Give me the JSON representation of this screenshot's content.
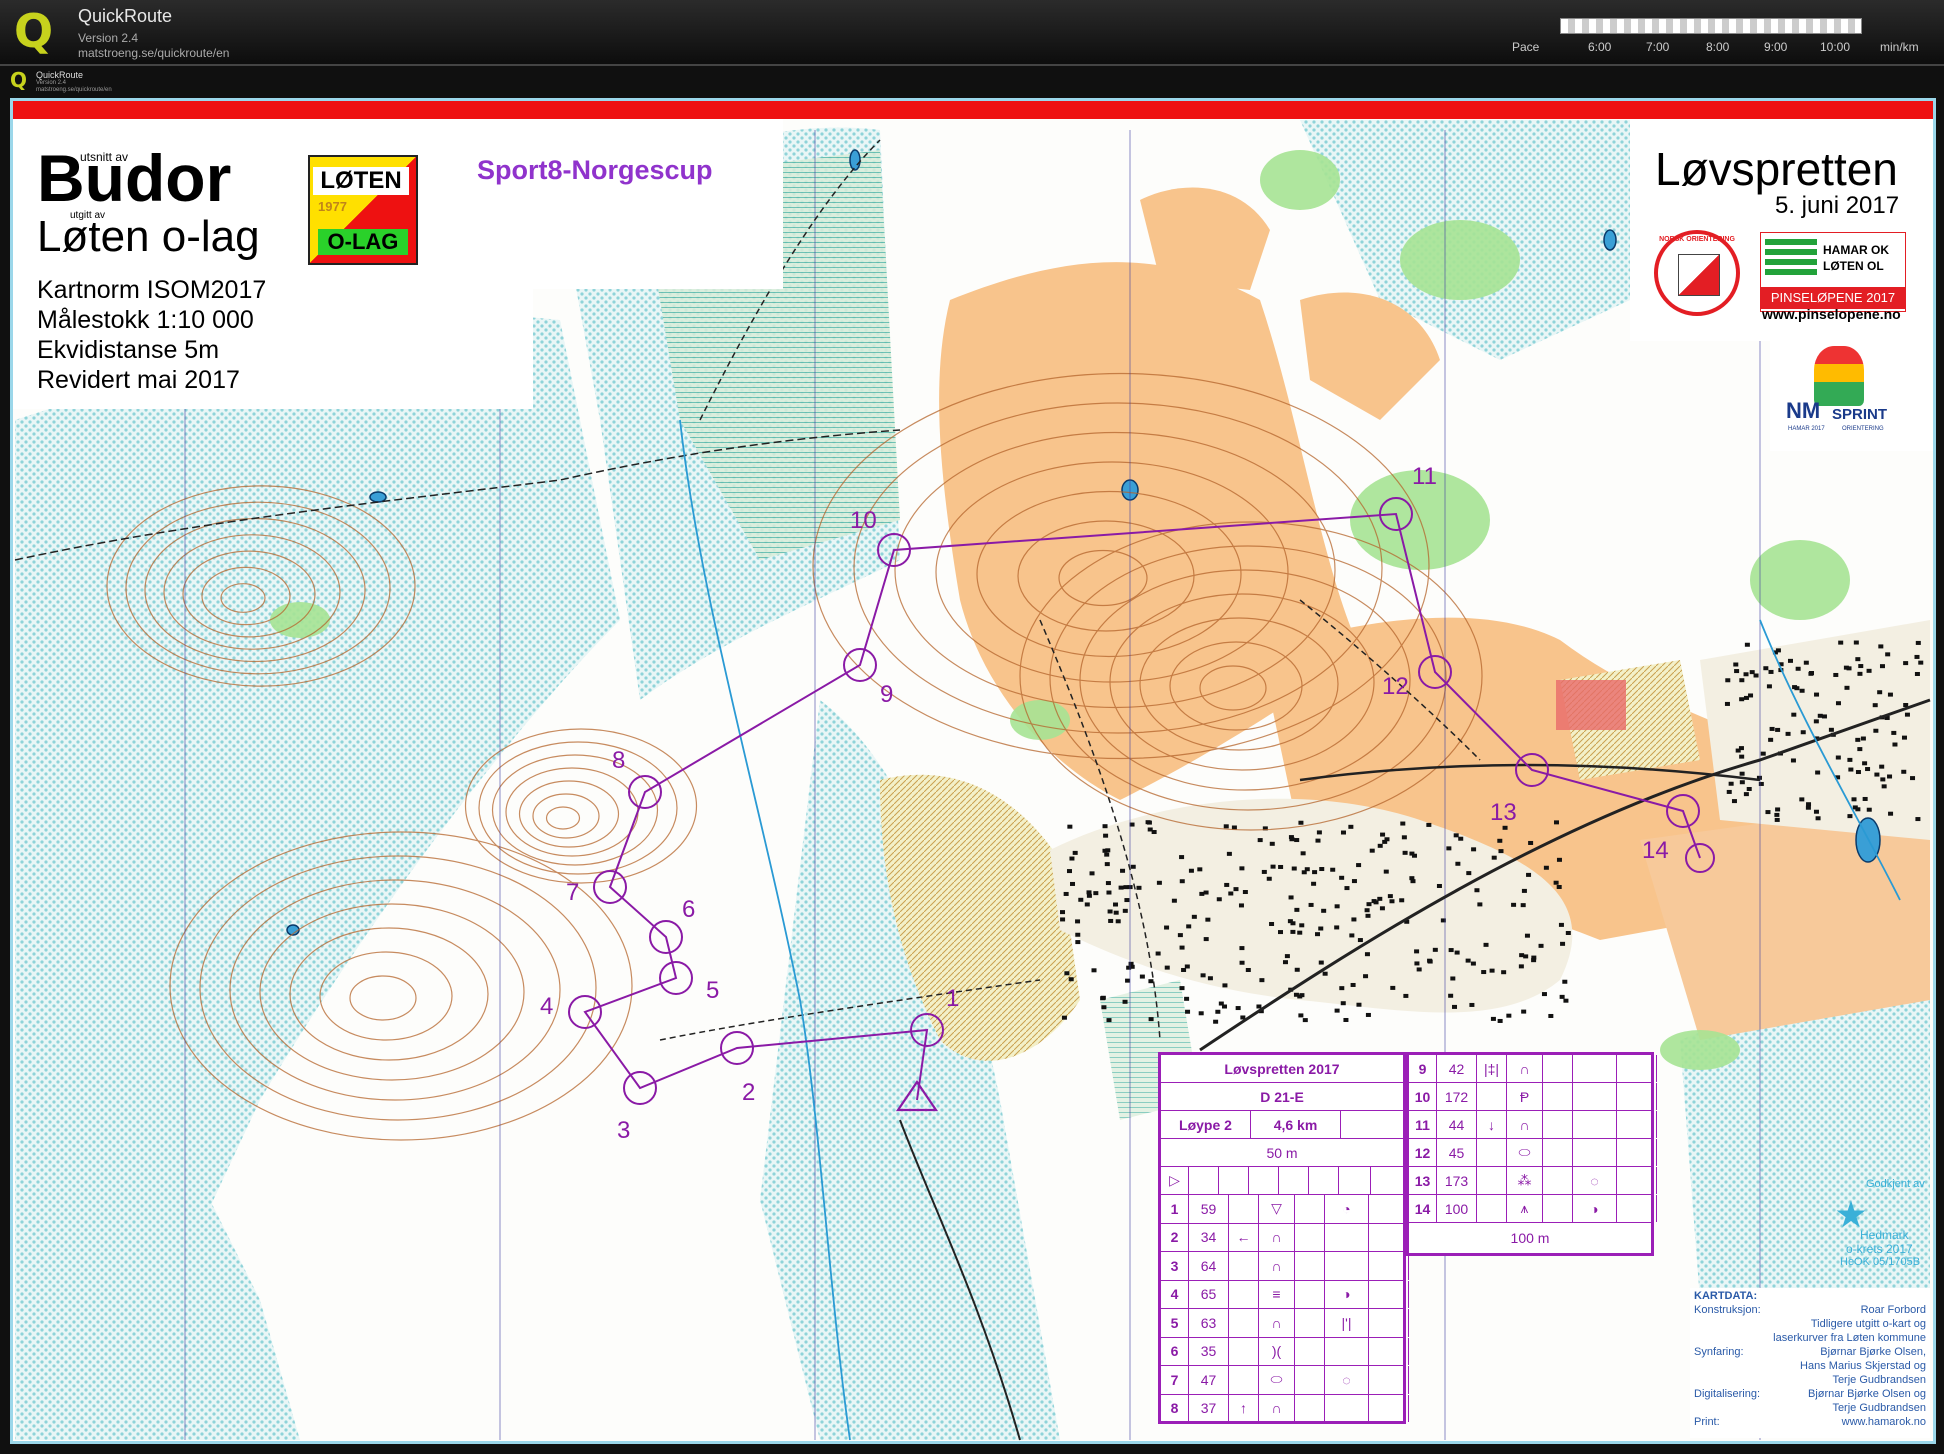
{
  "app": {
    "title": "QuickRoute",
    "version": "Version 2.4",
    "url": "matstroeng.se/quickroute/en",
    "logo_letter": "Q",
    "logo_icon": "quickroute-q-icon"
  },
  "pace_scale": {
    "label": "Pace",
    "ticks": [
      "6:00",
      "7:00",
      "8:00",
      "9:00",
      "10:00"
    ],
    "unit": "min/km"
  },
  "map_header": {
    "prefix": "utsnitt av",
    "area": "Budor",
    "publisher_prefix": "utgitt av",
    "publisher": "Løten o-lag",
    "info": [
      "Kartnorm ISOM2017",
      "Målestokk 1:10 000",
      "Ekvidistanse 5m",
      "Revidert mai 2017"
    ],
    "cup": "Sport8-Norgescup",
    "club_logo": {
      "top": "LØTEN",
      "year": "1977",
      "bottom": "O-LAG"
    },
    "event_title": "Løvspretten",
    "event_date": "5. juni 2017",
    "norsk_logo": "NORSK ORIENTERING",
    "hamar_logo": {
      "line1": "HAMAR OK",
      "line2": "LØTEN OL",
      "band": "PINSELØPENE 2017"
    },
    "pinse_url": "www.pinselopene.no",
    "nm_logo": {
      "main": "NM",
      "side": "SPRINT",
      "sub1": "HAMAR 2017",
      "sub2": "ORIENTERING"
    }
  },
  "controls": [
    {
      "n": "1"
    },
    {
      "n": "2"
    },
    {
      "n": "3"
    },
    {
      "n": "4"
    },
    {
      "n": "5"
    },
    {
      "n": "6"
    },
    {
      "n": "7"
    },
    {
      "n": "8"
    },
    {
      "n": "9"
    },
    {
      "n": "10"
    },
    {
      "n": "11"
    },
    {
      "n": "12"
    },
    {
      "n": "13"
    },
    {
      "n": "14"
    }
  ],
  "description_sheet": {
    "title": "Løvspretten 2017",
    "class": "D 21-E",
    "course": "Løype 2",
    "length": "4,6 km",
    "start_dist": "50 m",
    "finish_dist": "100 m",
    "rows_left": [
      {
        "n": "1",
        "code": "59",
        "sym1": "",
        "sym2": "▽",
        "sym3": "◔"
      },
      {
        "n": "2",
        "code": "34",
        "sym1": "←",
        "sym2": "∩",
        "sym3": ""
      },
      {
        "n": "3",
        "code": "64",
        "sym1": "",
        "sym2": "∩",
        "sym3": ""
      },
      {
        "n": "4",
        "code": "65",
        "sym1": "",
        "sym2": "≡",
        "sym3": "◑"
      },
      {
        "n": "5",
        "code": "63",
        "sym1": "",
        "sym2": "∩",
        "sym3": "|'|"
      },
      {
        "n": "6",
        "code": "35",
        "sym1": "",
        "sym2": ")(",
        "sym3": ""
      },
      {
        "n": "7",
        "code": "47",
        "sym1": "",
        "sym2": "⬭",
        "sym3": "◌"
      },
      {
        "n": "8",
        "code": "37",
        "sym1": "↑",
        "sym2": "∩",
        "sym3": ""
      }
    ],
    "rows_right": [
      {
        "n": "9",
        "code": "42",
        "sym1": "|‡|",
        "sym2": "∩",
        "sym3": ""
      },
      {
        "n": "10",
        "code": "172",
        "sym1": "",
        "sym2": "Ᵽ",
        "sym3": ""
      },
      {
        "n": "11",
        "code": "44",
        "sym1": "↓",
        "sym2": "∩",
        "sym3": ""
      },
      {
        "n": "12",
        "code": "45",
        "sym1": "",
        "sym2": "⬭",
        "sym3": ""
      },
      {
        "n": "13",
        "code": "173",
        "sym1": "",
        "sym2": "⁂",
        "sym3": "◌"
      },
      {
        "n": "14",
        "code": "100",
        "sym1": "",
        "sym2": "⩚",
        "sym3": "◑"
      }
    ]
  },
  "approval": {
    "line1": "Godkjent av",
    "line2": "Hedmark",
    "line3": "o-krets 2017",
    "line4": "HeOK 05/1705B"
  },
  "kartdata": {
    "title": "KARTDATA:",
    "entries": [
      {
        "label": "Konstruksjon:",
        "lines": [
          "Roar Forbord",
          "Tidligere utgitt o-kart og",
          "laserkurver fra Løten kommune"
        ]
      },
      {
        "label": "Synfaring:",
        "lines": [
          "Bjørnar Bjørke Olsen,",
          "Hans Marius Skjerstad og",
          "Terje Gudbrandsen"
        ]
      },
      {
        "label": "Digitalisering:",
        "lines": [
          "Bjørnar Bjørke Olsen og",
          "Terje Gudbrandsen"
        ]
      },
      {
        "label": "Print:",
        "lines": [
          "www.hamarok.no"
        ]
      }
    ]
  },
  "colors": {
    "course": "#8a1aa6",
    "frame": "#9bd7ea",
    "redbar": "#ee1111",
    "open_land": "#f8c48c",
    "forest_green": "#9fe08a",
    "vegetation_dot": "#a8dde0"
  }
}
